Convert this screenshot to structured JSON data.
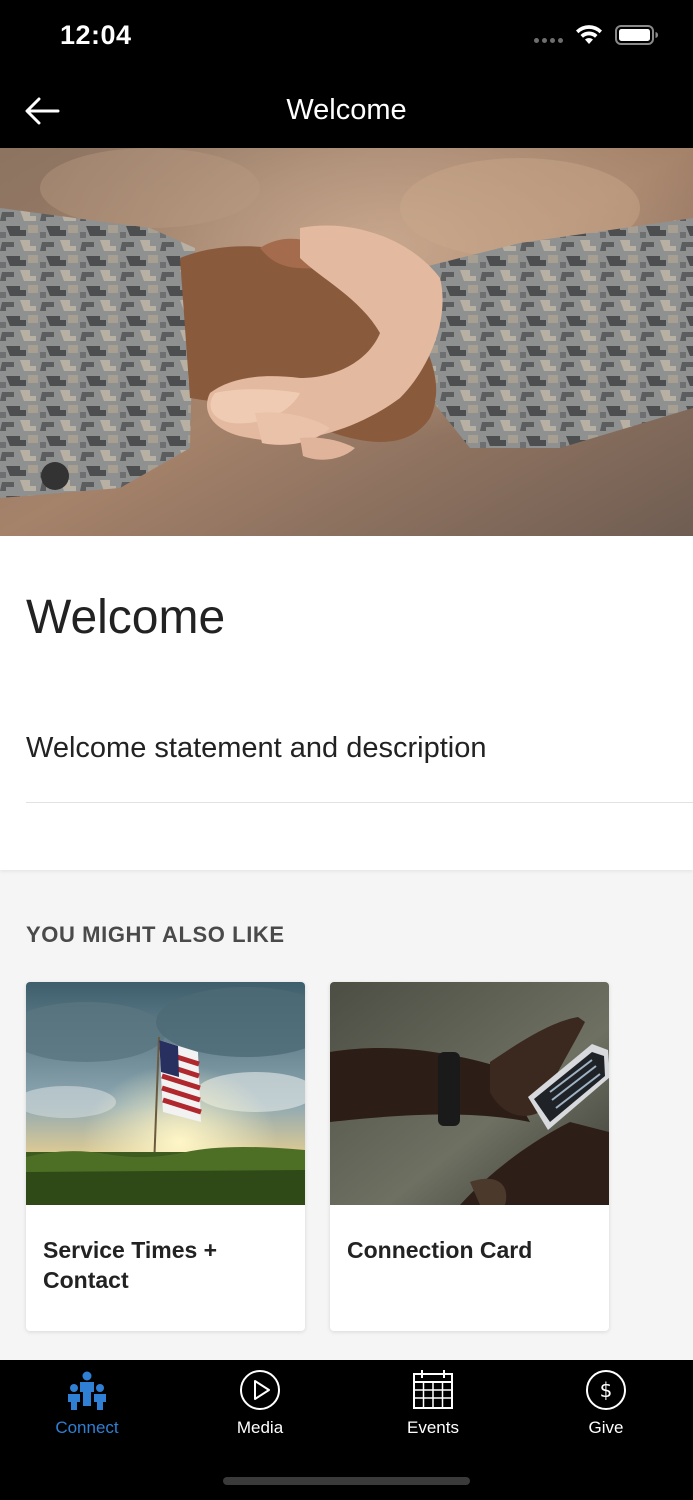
{
  "status_bar": {
    "time": "12:04"
  },
  "header": {
    "title": "Welcome",
    "back_icon": "arrow-left-icon"
  },
  "hero": {
    "alt": "Handshake between two people in camouflage uniforms"
  },
  "content": {
    "title": "Welcome",
    "description": "Welcome statement and description"
  },
  "suggestions": {
    "label": "YOU MIGHT ALSO LIKE",
    "items": [
      {
        "title": "Service Times + Contact",
        "image": "american-flag-sunset"
      },
      {
        "title": "Connection Card",
        "image": "hands-holding-phone"
      }
    ]
  },
  "tabbar": {
    "tabs": [
      {
        "label": "Connect",
        "icon": "people-icon",
        "active": true
      },
      {
        "label": "Media",
        "icon": "play-circle-icon",
        "active": false
      },
      {
        "label": "Events",
        "icon": "calendar-icon",
        "active": false
      },
      {
        "label": "Give",
        "icon": "dollar-circle-icon",
        "active": false
      }
    ]
  },
  "colors": {
    "accent": "#2f7fd4",
    "header_bg": "#000000",
    "page_bg": "#f5f5f5"
  }
}
